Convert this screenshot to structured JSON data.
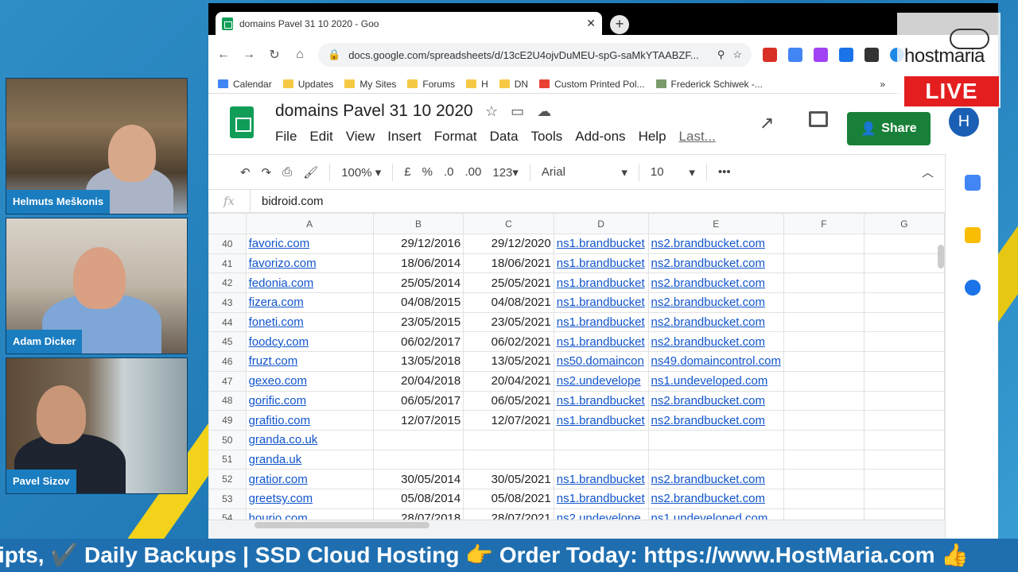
{
  "browser": {
    "tab_title": "domains Pavel 31 10 2020 - Goo",
    "url": "docs.google.com/spreadsheets/d/13cE2U4ojvDuMEU-spG-saMkYTAABZF...",
    "bookmarks": [
      "Calendar",
      "Updates",
      "My Sites",
      "Forums",
      "H",
      "DN",
      "Custom Printed Pol...",
      "Frederick Schiwek -..."
    ]
  },
  "doc": {
    "title": "domains Pavel 31 10 2020",
    "menu": [
      "File",
      "Edit",
      "View",
      "Insert",
      "Format",
      "Data",
      "Tools",
      "Add-ons",
      "Help"
    ],
    "last_edit": "Last...",
    "share_label": "Share",
    "avatar_letter": "H"
  },
  "toolbar": {
    "zoom": "100%",
    "currency": "£",
    "percent": "%",
    "dec_less": ".0",
    "dec_more": ".00",
    "format": "123",
    "font": "Arial",
    "font_size": "10",
    "more": "•••"
  },
  "formula_bar": {
    "fx": "fx",
    "value": "bidroid.com"
  },
  "grid": {
    "columns": [
      "A",
      "B",
      "C",
      "D",
      "E",
      "F",
      "G"
    ],
    "rows": [
      [
        "40",
        "favoric.com",
        "29/12/2016",
        "29/12/2020",
        "ns1.brandbucket",
        "ns2.brandbucket.com"
      ],
      [
        "41",
        "favorizo.com",
        "18/06/2014",
        "18/06/2021",
        "ns1.brandbucket",
        "ns2.brandbucket.com"
      ],
      [
        "42",
        "fedonia.com",
        "25/05/2014",
        "25/05/2021",
        "ns1.brandbucket",
        "ns2.brandbucket.com"
      ],
      [
        "43",
        "fizera.com",
        "04/08/2015",
        "04/08/2021",
        "ns1.brandbucket",
        "ns2.brandbucket.com"
      ],
      [
        "44",
        "foneti.com",
        "23/05/2015",
        "23/05/2021",
        "ns1.brandbucket",
        "ns2.brandbucket.com"
      ],
      [
        "45",
        "foodcy.com",
        "06/02/2017",
        "06/02/2021",
        "ns1.brandbucket",
        "ns2.brandbucket.com"
      ],
      [
        "46",
        "fruzt.com",
        "13/05/2018",
        "13/05/2021",
        "ns50.domaincon",
        "ns49.domaincontrol.com"
      ],
      [
        "47",
        "gexeo.com",
        "20/04/2018",
        "20/04/2021",
        "ns2.undevelope",
        "ns1.undeveloped.com"
      ],
      [
        "48",
        "gorific.com",
        "06/05/2017",
        "06/05/2021",
        "ns1.brandbucket",
        "ns2.brandbucket.com"
      ],
      [
        "49",
        "grafitio.com",
        "12/07/2015",
        "12/07/2021",
        "ns1.brandbucket",
        "ns2.brandbucket.com"
      ],
      [
        "50",
        "granda.co.uk",
        "",
        "",
        "",
        ""
      ],
      [
        "51",
        "granda.uk",
        "",
        "",
        "",
        ""
      ],
      [
        "52",
        "gratior.com",
        "30/05/2014",
        "30/05/2021",
        "ns1.brandbucket",
        "ns2.brandbucket.com"
      ],
      [
        "53",
        "greetsy.com",
        "05/08/2014",
        "05/08/2021",
        "ns1.brandbucket",
        "ns2.brandbucket.com"
      ],
      [
        "54",
        "hourio.com",
        "28/07/2018",
        "28/07/2021",
        "ns2.undevelope",
        "ns1.undeveloped.com"
      ]
    ]
  },
  "participants": [
    "Helmuts Meškonis",
    "Adam Dicker",
    "Pavel Sizov"
  ],
  "overlay": {
    "brand": "hostmaria",
    "live": "LIVE",
    "ticker": "ipts, ✔️ Daily Backups | SSD Cloud Hosting 👉 Order Today: https://www.HostMaria.com 👍"
  },
  "colors": {
    "link": "#1155cc",
    "share_green": "#188038",
    "live_red": "#e41e1e",
    "ticker_bg": "#1f6fb0",
    "label_bg": "#1a7dc0"
  }
}
